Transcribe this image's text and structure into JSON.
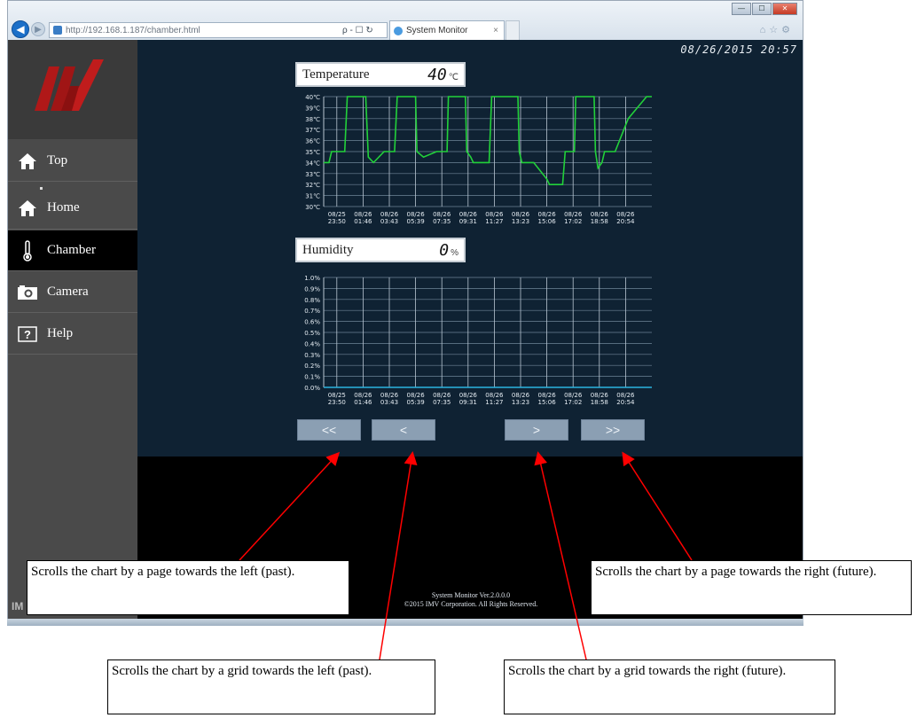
{
  "browser": {
    "url": "http://192.168.1.187/chamber.html",
    "tab_title": "System Monitor",
    "tab_close": "×",
    "address_tools": "ρ - ☐ ↻",
    "window_buttons": [
      "—",
      "☐",
      "✕"
    ],
    "right_icons": "⌂☆⚙"
  },
  "sidebar": {
    "items": [
      {
        "label": "Top",
        "icon": "home-icon"
      },
      {
        "label": "Home",
        "icon": "home-icon"
      },
      {
        "label": "Chamber",
        "icon": "thermometer-icon",
        "active": true
      },
      {
        "label": "Camera",
        "icon": "camera-icon"
      },
      {
        "label": "Help",
        "icon": "help-icon"
      }
    ],
    "brand_small": "IM"
  },
  "header": {
    "datetime": "08/26/2015 20:57"
  },
  "temperature": {
    "label": "Temperature",
    "value": "40",
    "unit": "℃"
  },
  "humidity": {
    "label": "Humidity",
    "value": "0",
    "unit": "%"
  },
  "chart_data": [
    {
      "type": "line",
      "name": "temperature-chart",
      "y_tick_labels": [
        "40℃",
        "39℃",
        "38℃",
        "37℃",
        "36℃",
        "35℃",
        "34℃",
        "33℃",
        "32℃",
        "31℃",
        "30℃"
      ],
      "ylim": [
        30,
        40
      ],
      "x_tick_labels": [
        [
          "08/25",
          "23:50"
        ],
        [
          "08/26",
          "01:46"
        ],
        [
          "08/26",
          "03:43"
        ],
        [
          "08/26",
          "05:39"
        ],
        [
          "08/26",
          "07:35"
        ],
        [
          "08/26",
          "09:31"
        ],
        [
          "08/26",
          "11:27"
        ],
        [
          "08/26",
          "13:23"
        ],
        [
          "08/26",
          "15:06"
        ],
        [
          "08/26",
          "17:02"
        ],
        [
          "08/26",
          "18:58"
        ],
        [
          "08/26",
          "20:54"
        ]
      ],
      "xlim": [
        0,
        11
      ],
      "grid": true,
      "line_color": "#22d13a",
      "series": [
        {
          "points": [
            [
              0,
              34
            ],
            [
              0.2,
              34
            ],
            [
              0.3,
              35
            ],
            [
              0.8,
              35
            ],
            [
              0.9,
              40
            ],
            [
              1.6,
              40
            ],
            [
              1.7,
              34.5
            ],
            [
              1.9,
              34
            ],
            [
              2.3,
              35
            ],
            [
              2.7,
              35
            ],
            [
              2.8,
              40
            ],
            [
              3.5,
              40
            ],
            [
              3.55,
              35
            ],
            [
              3.8,
              34.5
            ],
            [
              4.3,
              35
            ],
            [
              4.7,
              35
            ],
            [
              4.75,
              40
            ],
            [
              5.4,
              40
            ],
            [
              5.45,
              35
            ],
            [
              5.6,
              34.5
            ],
            [
              5.7,
              34
            ],
            [
              6.3,
              34
            ],
            [
              6.4,
              40
            ],
            [
              7.4,
              40
            ],
            [
              7.45,
              35
            ],
            [
              7.55,
              34
            ],
            [
              8.0,
              34
            ],
            [
              8.5,
              32.5
            ],
            [
              8.6,
              32
            ],
            [
              9.1,
              32
            ],
            [
              9.2,
              35
            ],
            [
              9.55,
              35
            ],
            [
              9.6,
              40
            ],
            [
              10.3,
              40
            ],
            [
              10.35,
              35
            ],
            [
              10.45,
              33.5
            ],
            [
              10.6,
              34
            ],
            [
              10.7,
              35
            ],
            [
              11.1,
              35
            ],
            [
              11.6,
              38
            ],
            [
              12.3,
              40
            ],
            [
              12.5,
              40
            ]
          ]
        }
      ]
    },
    {
      "type": "line",
      "name": "humidity-chart",
      "y_tick_labels": [
        "1.0%",
        "0.9%",
        "0.8%",
        "0.7%",
        "0.6%",
        "0.5%",
        "0.4%",
        "0.3%",
        "0.2%",
        "0.1%",
        "0.0%"
      ],
      "ylim": [
        0,
        1.0
      ],
      "x_tick_labels": [
        [
          "08/25",
          "23:50"
        ],
        [
          "08/26",
          "01:46"
        ],
        [
          "08/26",
          "03:43"
        ],
        [
          "08/26",
          "05:39"
        ],
        [
          "08/26",
          "07:35"
        ],
        [
          "08/26",
          "09:31"
        ],
        [
          "08/26",
          "11:27"
        ],
        [
          "08/26",
          "13:23"
        ],
        [
          "08/26",
          "15:06"
        ],
        [
          "08/26",
          "17:02"
        ],
        [
          "08/26",
          "18:58"
        ],
        [
          "08/26",
          "20:54"
        ]
      ],
      "xlim": [
        0,
        11
      ],
      "grid": true,
      "line_color": "#2bb3e0",
      "series": [
        {
          "points": [
            [
              0,
              0
            ],
            [
              12.5,
              0
            ]
          ]
        }
      ]
    }
  ],
  "scroll_buttons": {
    "first": "<<",
    "prev": "<",
    "next": ">",
    "last": ">>"
  },
  "footer": {
    "line1": "System Monitor Ver.2.0.0.0",
    "line2": "©2015 IMV Corporation. All Rights Reserved."
  },
  "callouts": {
    "page_left": "Scrolls the chart by a page towards the left (past).",
    "page_right": "Scrolls the chart by a page towards the right (future).",
    "grid_left": "Scrolls the chart by a grid towards the left (past).",
    "grid_right": "Scrolls the chart by a grid towards the right (future)."
  },
  "colors": {
    "main_bg": "#0f2233",
    "sidebar_bg": "#4a4a4a",
    "logo_red": "#b01818",
    "annotation_arrow": "#ff0000"
  }
}
